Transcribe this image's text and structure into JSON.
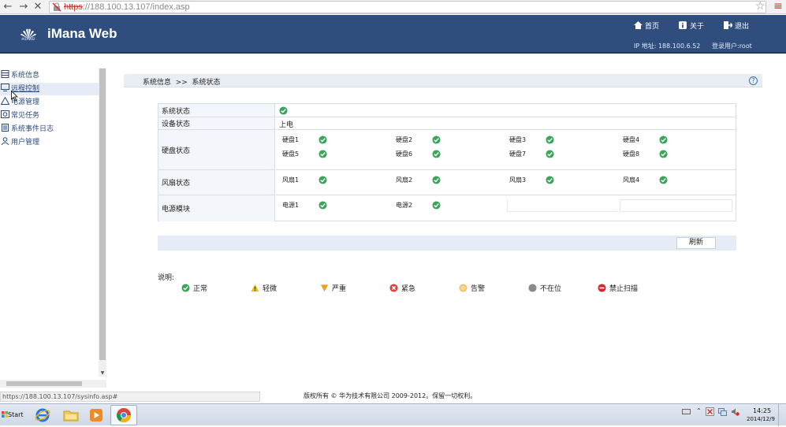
{
  "browser": {
    "url_scheme": "https",
    "url_rest": "://188.100.13.107/index.asp"
  },
  "header": {
    "brand_sub": "HUAWEI",
    "app_title": "iMana Web",
    "links": [
      {
        "label": "首页",
        "icon": "home-icon"
      },
      {
        "label": "关于",
        "icon": "info-icon"
      },
      {
        "label": "退出",
        "icon": "logout-icon"
      }
    ],
    "ip_label": "IP 地址: 188.100.6.52",
    "login_label": "登录用户:root"
  },
  "sidebar": {
    "items": [
      {
        "label": "系统信息",
        "icon": "server-icon"
      },
      {
        "label": "远程控制",
        "icon": "monitor-icon"
      },
      {
        "label": "电源管理",
        "icon": "power-warning-icon"
      },
      {
        "label": "常见任务",
        "icon": "tasks-icon"
      },
      {
        "label": "系统事件日志",
        "icon": "log-icon"
      },
      {
        "label": "用户管理",
        "icon": "user-icon"
      }
    ]
  },
  "breadcrumb": {
    "text": "系统信息  >>  系统状态",
    "help": "?"
  },
  "status": {
    "system_label": "系统状态",
    "device_label": "设备状态",
    "device_value": "上电",
    "disk_label": "硬盘状态",
    "disks": [
      "硬盘1",
      "硬盘2",
      "硬盘3",
      "硬盘4",
      "硬盘5",
      "硬盘6",
      "硬盘7",
      "硬盘8"
    ],
    "fan_label": "风扇状态",
    "fans": [
      "风扇1",
      "风扇2",
      "风扇3",
      "风扇4"
    ],
    "power_label": "电源模块",
    "psus": [
      "电源1",
      "电源2"
    ],
    "ok_color": "#3aa55a"
  },
  "refresh_label": "刷新",
  "legend": {
    "title": "说明:",
    "items": [
      {
        "label": "正常",
        "icon": "ok-icon",
        "color": "#3aa55a"
      },
      {
        "label": "轻微",
        "icon": "minor-warning-icon",
        "color": "#e8c21a"
      },
      {
        "label": "严重",
        "icon": "major-triangle-icon",
        "color": "#f0a020"
      },
      {
        "label": "紧急",
        "icon": "critical-icon",
        "color": "#e0403a"
      },
      {
        "label": "告警",
        "icon": "alarm-icon",
        "color": "#f3c26a"
      },
      {
        "label": "不在位",
        "icon": "absent-icon",
        "color": "#8a8a8a"
      },
      {
        "label": "禁止扫描",
        "icon": "no-scan-icon",
        "color": "#d9262c"
      }
    ]
  },
  "status_bar_url": "https://188.100.13.107/sysinfo.asp#",
  "footer": "版权所有 © 华为技术有限公司 2009-2012。保留一切权利。",
  "taskbar": {
    "start": "Start",
    "time": "14:25",
    "date": "2014/12/9"
  }
}
